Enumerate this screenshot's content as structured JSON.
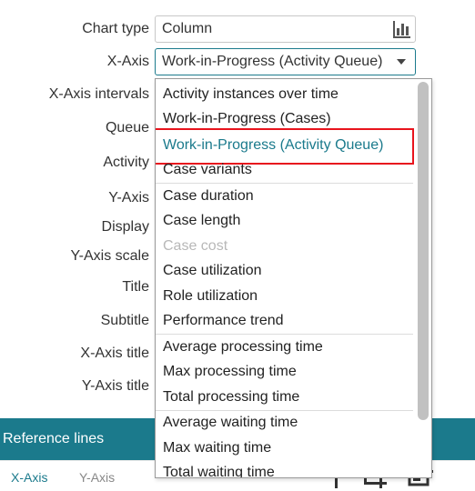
{
  "form": {
    "labels": {
      "chart_type": "Chart type",
      "x_axis": "X-Axis",
      "x_axis_intervals": "X-Axis intervals",
      "queue": "Queue",
      "activity": "Activity",
      "y_axis": "Y-Axis",
      "display": "Display",
      "y_axis_scale": "Y-Axis scale",
      "title": "Title",
      "subtitle": "Subtitle",
      "x_axis_title": "X-Axis title",
      "y_axis_title": "Y-Axis title"
    },
    "chart_type_value": "Column",
    "chart_type_icon": "bar-chart-icon",
    "x_axis_value": "Work-in-Progress (Activity Queue)"
  },
  "dropdown": {
    "options": [
      "Activity instances over time",
      "Work-in-Progress (Cases)",
      "Work-in-Progress (Activity Queue)",
      "Case variants",
      "Case duration",
      "Case length",
      "Case cost",
      "Case utilization",
      "Role utilization",
      "Performance trend",
      "Average processing time",
      "Max processing time",
      "Total processing time",
      "Average waiting time",
      "Max waiting time",
      "Total waiting time"
    ],
    "selected_option": "Work-in-Progress (Activity Queue)",
    "disabled_option": "Case cost"
  },
  "reference_lines": {
    "header": "Reference lines",
    "tabs": [
      "X-Axis",
      "Y-Axis"
    ],
    "active_tab": "X-Axis"
  },
  "colors": {
    "accent": "#1b7a8c",
    "highlight_border": "#e8141d",
    "disabled_text": "#b8b8b8"
  }
}
